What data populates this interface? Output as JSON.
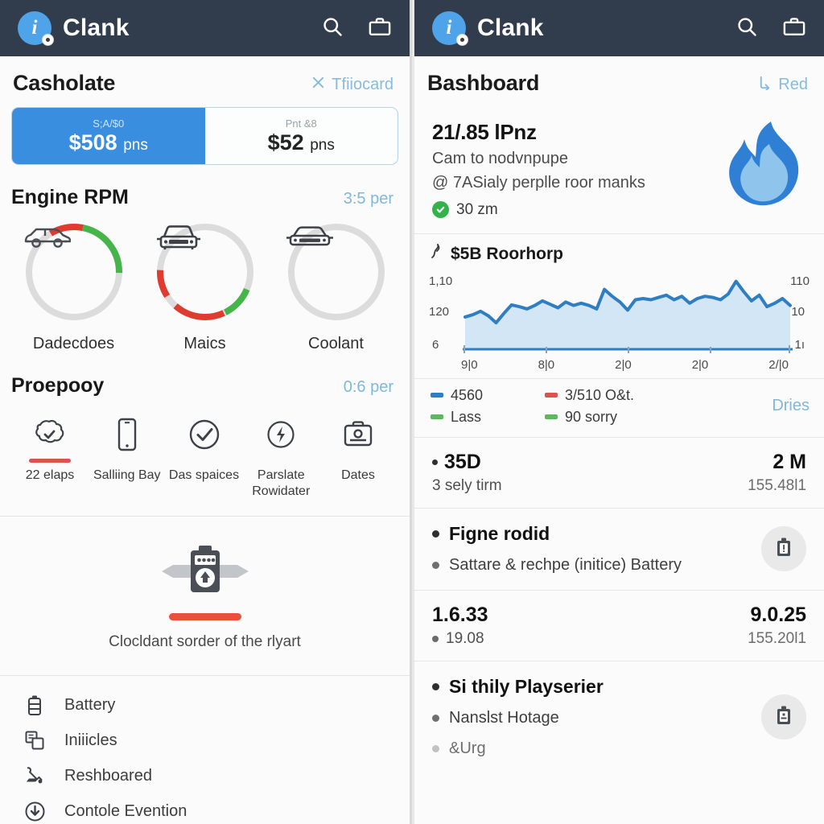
{
  "appbar": {
    "title": "Clank",
    "avatar_letter": "i",
    "search_icon": "search-icon",
    "briefcase_icon": "briefcase-icon"
  },
  "left": {
    "header": {
      "title": "Casholate",
      "link": "Tfiiocard",
      "link_icon": "close-x-icon"
    },
    "segmented": [
      {
        "caption": "S;A/$0",
        "value": "$508",
        "unit": "pns",
        "active": true
      },
      {
        "caption": "Pnt &8",
        "value": "$52",
        "unit": "pns",
        "active": false
      }
    ],
    "engine_section": {
      "title": "Engine RPM",
      "meta": "3:5 per"
    },
    "gauges": [
      {
        "label": "Dadecdoes",
        "icon": "suv-car-icon",
        "red_pct": 12,
        "green_pct": 22,
        "rotate": -38
      },
      {
        "label": "Maics",
        "icon": "front-car-icon",
        "red_pct": 10,
        "green_pct": 12,
        "rotate": 120
      },
      {
        "label": "Coolant",
        "icon": "sedan-car-icon",
        "red_pct": 0,
        "green_pct": 0,
        "rotate": 0
      }
    ],
    "quick_section": {
      "title": "Proepooy",
      "meta": "0:6 per"
    },
    "quick_items": [
      {
        "label": "22 elaps",
        "icon": "cloud-check-icon",
        "underline": true
      },
      {
        "label": "Salliing Bay",
        "icon": "phone-icon",
        "underline": false
      },
      {
        "label": "Das spaices",
        "icon": "check-circle-icon",
        "underline": false
      },
      {
        "label": "Parslate Rowidater",
        "icon": "bolt-circle-icon",
        "underline": false
      },
      {
        "label": "Dates",
        "icon": "toolbox-icon",
        "underline": false
      }
    ],
    "empty_card": {
      "icon": "battery-module-icon",
      "text": "Clocldant sorder of the rlyart"
    },
    "menu": [
      {
        "label": "Battery",
        "icon": "battery-icon"
      },
      {
        "label": "Iniiicles",
        "icon": "windows-grid-icon"
      },
      {
        "label": "Reshboared",
        "icon": "tools-icon"
      },
      {
        "label": "Contole Evention",
        "icon": "download-circle-icon"
      }
    ]
  },
  "right": {
    "header": {
      "title": "Bashboard",
      "link": "Red",
      "link_icon": "share-icon"
    },
    "hero": {
      "title": "21/.85 lPnz",
      "sub_line1": "Cam to nodvnpupe",
      "sub_line2": "@ 7ASialy perplle roor manks",
      "status": "30 zm",
      "status_icon": "check-badge-icon",
      "art_icon": "blue-flame-icon"
    },
    "legend": {
      "items": [
        {
          "label": "4560",
          "color": "#2f7ec4"
        },
        {
          "label": "3/510 O&t.",
          "color": "#d9534f"
        },
        {
          "label": "Lass",
          "color": "#5cb85c"
        },
        {
          "label": "90 sorry",
          "color": "#5cb85c"
        }
      ],
      "link": "Dries"
    },
    "stat_rows": [
      {
        "left_big": "35D",
        "left_small": "3 sely tirm",
        "left_bullet": true,
        "right_big": "2 M",
        "right_small": "155.48l1"
      },
      {
        "left_big": "1.6.33",
        "left_small": "19.08",
        "left_bullet": false,
        "right_big": "9.0.25",
        "right_small": "155.20l1"
      }
    ],
    "bullet_rows": [
      {
        "title": "Figne rodid",
        "items": [
          {
            "text": "Sattare & rechpe (initice) Battery",
            "muted": false
          }
        ],
        "button_icon": "battery-module-icon"
      },
      {
        "title": "Si thily Playserier",
        "items": [
          {
            "text": "Nanslst Hotage",
            "muted": false
          },
          {
            "text": "&Urg",
            "muted": true
          }
        ],
        "button_icon": "battery-module-icon"
      }
    ]
  },
  "chart_data": {
    "type": "area",
    "title": "$5B Roorhorp",
    "title_icon": "trend-icon",
    "xlabel": "",
    "ylabel": "",
    "ylim": [
      0,
      130
    ],
    "ytick_labels_left": [
      "1,10",
      "120",
      "6"
    ],
    "ytick_labels_right": [
      "110",
      "10",
      "1ı"
    ],
    "xtick_labels": [
      "9|0",
      "8|0",
      "2|0",
      "2|0",
      "2/|0"
    ],
    "grid": false,
    "legend_position": "below",
    "line_color": "#2f7ec4",
    "fill_color": "#d3e6f5",
    "x": [
      0,
      1,
      2,
      3,
      4,
      5,
      6,
      7,
      8,
      9,
      10,
      11,
      12,
      13,
      14,
      15,
      16,
      17,
      18,
      19,
      20,
      21,
      22,
      23,
      24,
      25,
      26,
      27,
      28,
      29,
      30,
      31,
      32,
      33,
      34,
      35,
      36,
      37,
      38,
      39
    ],
    "values": [
      56,
      60,
      66,
      58,
      46,
      62,
      77,
      74,
      70,
      76,
      84,
      78,
      72,
      82,
      76,
      80,
      76,
      70,
      104,
      92,
      82,
      68,
      86,
      88,
      86,
      90,
      94,
      86,
      92,
      80,
      88,
      92,
      90,
      86,
      96,
      118,
      100,
      84,
      94,
      74,
      80,
      88,
      76
    ]
  }
}
